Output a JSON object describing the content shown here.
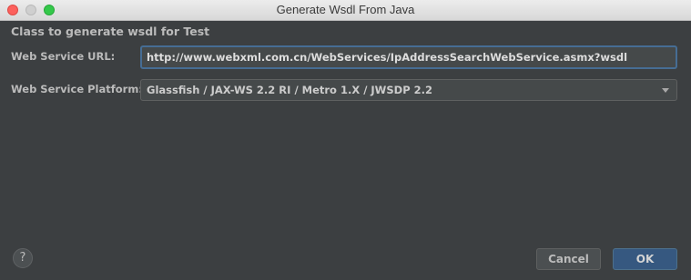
{
  "window": {
    "title": "Generate Wsdl From Java"
  },
  "form": {
    "heading": "Class to generate wsdl for  Test",
    "url_label": "Web Service URL:",
    "url_value": "http://www.webxml.com.cn/WebServices/IpAddressSearchWebService.asmx?wsdl",
    "platform_label": "Web Service Platform:",
    "platform_selected": "Glassfish / JAX-WS 2.2 RI / Metro 1.X / JWSDP 2.2"
  },
  "footer": {
    "help_label": "?",
    "cancel_label": "Cancel",
    "ok_label": "OK"
  },
  "colors": {
    "background": "#3c3f41",
    "input_focus_border": "#466d94",
    "ok_button": "#365880"
  },
  "icons": {
    "window_close": "close-icon",
    "window_minimize": "minimize-icon",
    "window_maximize": "maximize-icon",
    "dropdown": "chevron-down-icon",
    "help": "help-icon"
  }
}
